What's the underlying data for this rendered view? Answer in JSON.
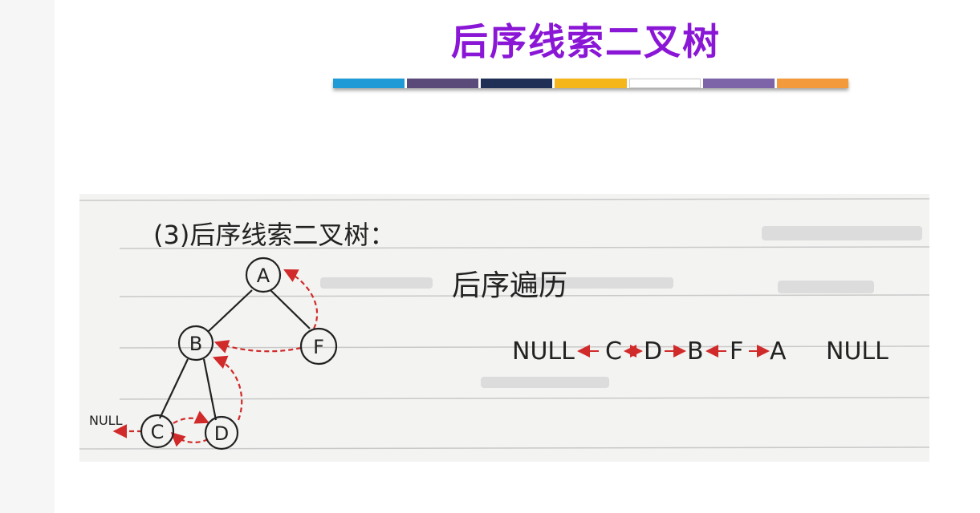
{
  "slide": {
    "title": "后序线索二叉树",
    "bar_colors": [
      "#1e9ad6",
      "#5a4a7a",
      "#1f2f55",
      "#f4b61a",
      "#ffffff",
      "#7d63a8",
      "#f29a3c"
    ]
  },
  "note": {
    "heading": "(3)后序线索二叉树：",
    "traversal_label": "后序遍历",
    "tree": {
      "nodes": [
        "A",
        "B",
        "F",
        "C",
        "D"
      ],
      "null_label": "NULL"
    },
    "sequence": {
      "start": "NULL",
      "items": [
        "C",
        "D",
        "B",
        "F",
        "A"
      ],
      "end": "NULL"
    }
  }
}
